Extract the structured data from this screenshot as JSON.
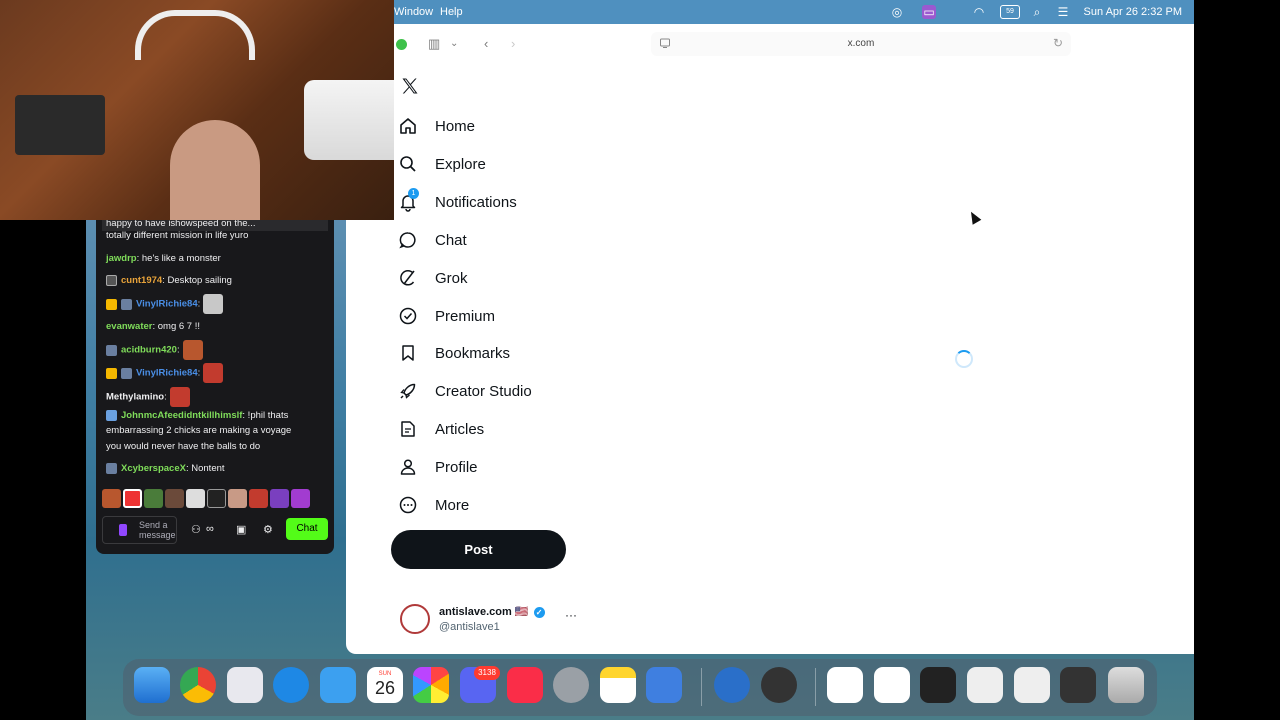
{
  "menubar": {
    "items": [
      "Window",
      "Help"
    ],
    "datetime": "Sun Apr 26  2:32 PM",
    "icons": [
      "chrome-icon",
      "screen-mirror-icon",
      "wifi-icon",
      "battery-icon",
      "search-icon",
      "control-center-icon"
    ]
  },
  "browser": {
    "url": "x.com",
    "buttons": [
      "sidebar-toggle-icon",
      "chevron-down-icon",
      "back-icon",
      "forward-icon",
      "reload-icon"
    ]
  },
  "x": {
    "nav": [
      {
        "label": "Home",
        "icon": "home-icon"
      },
      {
        "label": "Explore",
        "icon": "search-icon"
      },
      {
        "label": "Notifications",
        "icon": "bell-icon",
        "badge": "1"
      },
      {
        "label": "Chat",
        "icon": "chat-bubble-icon"
      },
      {
        "label": "Grok",
        "icon": "grok-icon"
      },
      {
        "label": "Premium",
        "icon": "premium-check-icon"
      },
      {
        "label": "Bookmarks",
        "icon": "bookmark-icon"
      },
      {
        "label": "Creator Studio",
        "icon": "rocket-icon"
      },
      {
        "label": "Articles",
        "icon": "article-icon"
      },
      {
        "label": "Profile",
        "icon": "person-icon"
      },
      {
        "label": "More",
        "icon": "more-circle-icon"
      }
    ],
    "post_label": "Post",
    "account": {
      "name": "antislave.com 🇺🇸",
      "handle": "@antislave1",
      "more": "···"
    }
  },
  "chat": {
    "top_text": "happy to have ishowspeed on the...",
    "messages": [
      {
        "user": "",
        "text": "totally different mission in life yuro",
        "color": "#efeff1"
      },
      {
        "user": "jawdrp",
        "text": ": he's like a monster",
        "color": "#7fdc5a"
      },
      {
        "user": "cunt1974",
        "text": ": Desktop sailing",
        "color": "#e8a33a"
      },
      {
        "user": "VinylRichie84",
        "text": ":",
        "color": "#4a8fe7"
      },
      {
        "user": "evanwater",
        "text": ": omg 6 7 !!",
        "color": "#7fdc5a"
      },
      {
        "user": "acidburn420",
        "text": ":",
        "color": "#7fdc5a"
      },
      {
        "user": "VinylRichie84",
        "text": ":",
        "color": "#4a8fe7"
      },
      {
        "user": "Methylamino",
        "text": ":",
        "color": "#efeff1"
      },
      {
        "user": "JohnmcAfeedidntkillhimslf",
        "text": ": !phil thats",
        "color": "#7fdc5a"
      },
      {
        "user": "",
        "text": "embarrassing 2 chicks are making a voyage",
        "color": "#efeff1"
      },
      {
        "user": "",
        "text": "you would never have the balls to do",
        "color": "#efeff1"
      },
      {
        "user": "XcyberspaceX",
        "text": ": Nontent",
        "color": "#7fdc5a"
      }
    ],
    "input_placeholder": "Send a message",
    "send_label": "Chat"
  },
  "dock": {
    "calendar_month": "SUN",
    "calendar_day": "26",
    "discord_badge": "3138"
  }
}
